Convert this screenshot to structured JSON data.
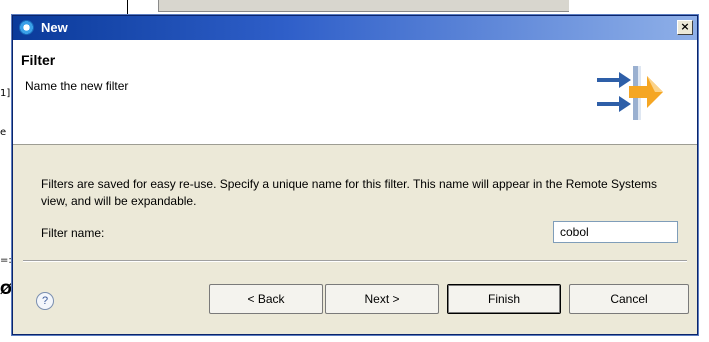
{
  "background": {
    "fragments": [
      "1]",
      "e",
      "=:",
      "Ø"
    ]
  },
  "dialog": {
    "title": "New",
    "close_label": "×",
    "banner": {
      "title": "Filter",
      "description": "Name the new filter"
    },
    "body": {
      "message": "Filters are saved for easy re-use. Specify a unique name for this filter. This name will appear in the Remote Systems view, and will be expandable.",
      "field_label": "Filter name:",
      "field_value": "cobol"
    },
    "buttons": {
      "help": "?",
      "back": "< Back",
      "next": "Next >",
      "finish": "Finish",
      "cancel": "Cancel"
    }
  },
  "colors": {
    "titlebar_start": "#0a3a9a",
    "titlebar_end": "#8fb0e8",
    "dialog_bg": "#ece9d8",
    "arrow_blue": "#2e5fa8",
    "arrow_orange": "#f5a623"
  }
}
